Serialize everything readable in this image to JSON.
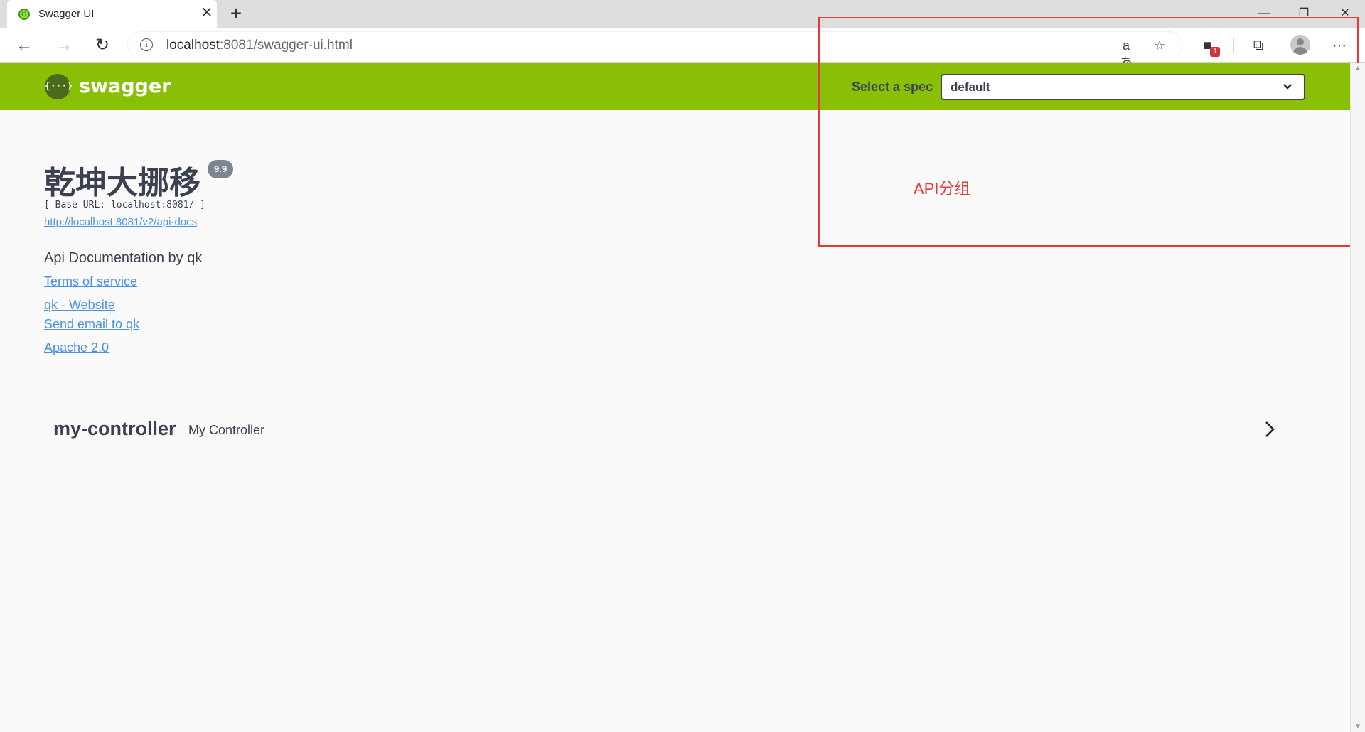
{
  "browser": {
    "tab_title": "Swagger UI",
    "url_host": "localhost",
    "url_rest": ":8081/swagger-ui.html",
    "new_tab_label": "+",
    "extension_badge": "1"
  },
  "topbar": {
    "logo_text": "swagger",
    "logo_glyph": "{···}",
    "spec_label": "Select a spec",
    "spec_selected": "default"
  },
  "info": {
    "title": "乾坤大挪移",
    "version": "9.9",
    "base_url": "[ Base URL: localhost:8081/ ]",
    "docs_link": "http://localhost:8081/v2/api-docs",
    "description": "Api Documentation by qk",
    "terms_link": "Terms of service",
    "website_link": "qk - Website",
    "email_link": "Send email to qk",
    "license_link": "Apache 2.0"
  },
  "tags": [
    {
      "name": "my-controller",
      "description": "My Controller"
    }
  ],
  "annotation": {
    "text": "API分组",
    "color": "#e53935"
  },
  "colors": {
    "topbar": "#89bf04",
    "link": "#4990e2",
    "text": "#3b4151",
    "badge": "#7d8492"
  },
  "icons": [
    "swagger-favicon-icon",
    "close-icon",
    "back-icon",
    "forward-icon",
    "reload-icon",
    "info-icon",
    "read-aloud-icon",
    "favorite-add-icon",
    "extension-icon",
    "collections-icon",
    "more-icon",
    "swagger-logo-icon",
    "chevron-down-icon",
    "chevron-right-icon"
  ]
}
